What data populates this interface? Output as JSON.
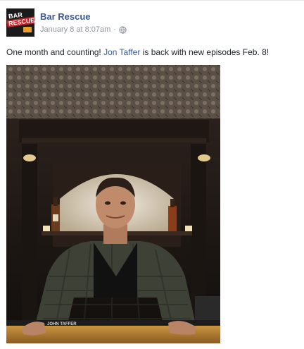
{
  "post": {
    "page_name": "Bar Rescue",
    "timestamp": "January 8 at 8:07am",
    "separator": "·",
    "privacy_icon": "globe-icon",
    "text_before": "One month and counting! ",
    "mention": "Jon Taffer",
    "text_after": " is back with new episodes Feb. 8!"
  },
  "avatar": {
    "line1": "BAR",
    "line2": "RESCUE"
  },
  "photo": {
    "bar_rail_text": "JOHN TAFFER"
  },
  "colors": {
    "link": "#3b5998",
    "meta": "#90949c",
    "text": "#1d2129"
  }
}
